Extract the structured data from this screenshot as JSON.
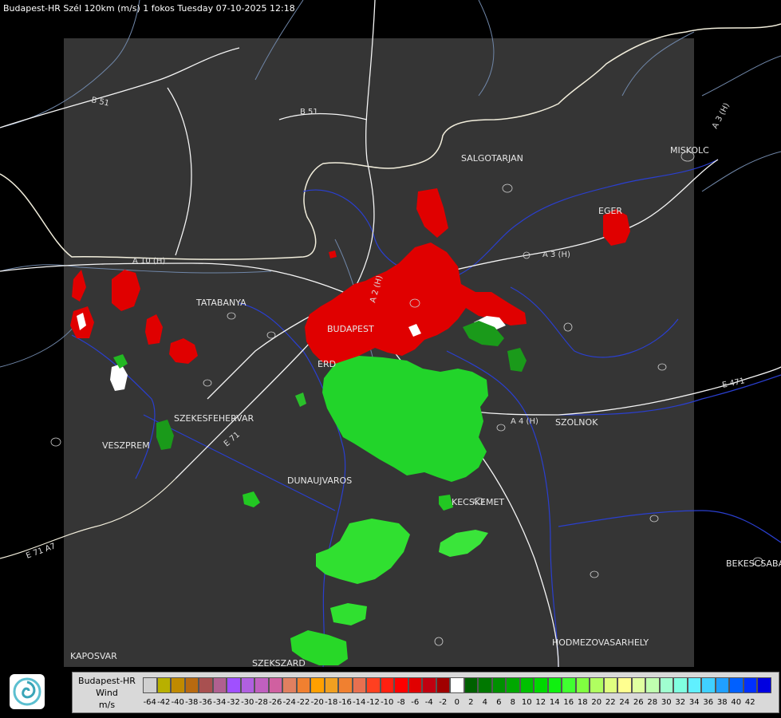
{
  "header": {
    "title": "Budapest-HR Szél 120km (m/s) 1 fokos Tuesday 07-10-2025 12:18"
  },
  "cities": [
    {
      "name": "SALGOTARJAN"
    },
    {
      "name": "MISKOLC"
    },
    {
      "name": "EGER"
    },
    {
      "name": "TATABANYA"
    },
    {
      "name": "BUDAPEST"
    },
    {
      "name": "ERD"
    },
    {
      "name": "SZEKESFEHERVAR"
    },
    {
      "name": "VESZPREM"
    },
    {
      "name": "DUNAUJVAROS"
    },
    {
      "name": "KECSKEMET"
    },
    {
      "name": "SZOLNOK"
    },
    {
      "name": "BEKESCSABA"
    },
    {
      "name": "HODMEZOVASARHELY"
    },
    {
      "name": "KAPOSVAR"
    },
    {
      "name": "SZEKSZARD"
    }
  ],
  "roads": [
    {
      "name": "B 51"
    },
    {
      "name": "B 51"
    },
    {
      "name": "A 3 (H)"
    },
    {
      "name": "A 3 (H)"
    },
    {
      "name": "A 4 (H)"
    },
    {
      "name": "A 2 (H)"
    },
    {
      "name": "E 471"
    },
    {
      "name": "A 10 (H)"
    },
    {
      "name": "E 71"
    },
    {
      "name": "E 71 A7"
    }
  ],
  "legend": {
    "line1": "Budapest-HR",
    "line2": "Wind",
    "line3": "m/s",
    "colors": [
      "#d0d0d0",
      "#b8b000",
      "#c08a00",
      "#b86a10",
      "#a85050",
      "#b06090",
      "#a050ff",
      "#b060e0",
      "#c060c0",
      "#d060a0",
      "#e08060",
      "#f08030",
      "#ffa000",
      "#f0a020",
      "#f08030",
      "#e87050",
      "#ff4020",
      "#ff2010",
      "#ff0000",
      "#e00000",
      "#c00010",
      "#a00000",
      "#ffffff",
      "#006000",
      "#007800",
      "#009000",
      "#00a800",
      "#00c000",
      "#00d800",
      "#10f010",
      "#40ff30",
      "#80ff40",
      "#b0ff60",
      "#e0ff80",
      "#ffff90",
      "#e0ffa0",
      "#c0ffb0",
      "#a0ffd0",
      "#80ffe0",
      "#60f0ff",
      "#40d0ff",
      "#20a0ff",
      "#0060ff",
      "#0030ff",
      "#0000e0"
    ],
    "ticks": [
      "-64",
      "-42",
      "-40",
      "-38",
      "-36",
      "-34",
      "-32",
      "-30",
      "-28",
      "-26",
      "-24",
      "-22",
      "-20",
      "-18",
      "-16",
      "-14",
      "-12",
      "-10",
      "-8",
      "-6",
      "-4",
      "-2",
      "0",
      "2",
      "4",
      "6",
      "8",
      "10",
      "12",
      "14",
      "16",
      "18",
      "20",
      "22",
      "24",
      "26",
      "28",
      "30",
      "32",
      "34",
      "36",
      "38",
      "40",
      "42"
    ]
  }
}
